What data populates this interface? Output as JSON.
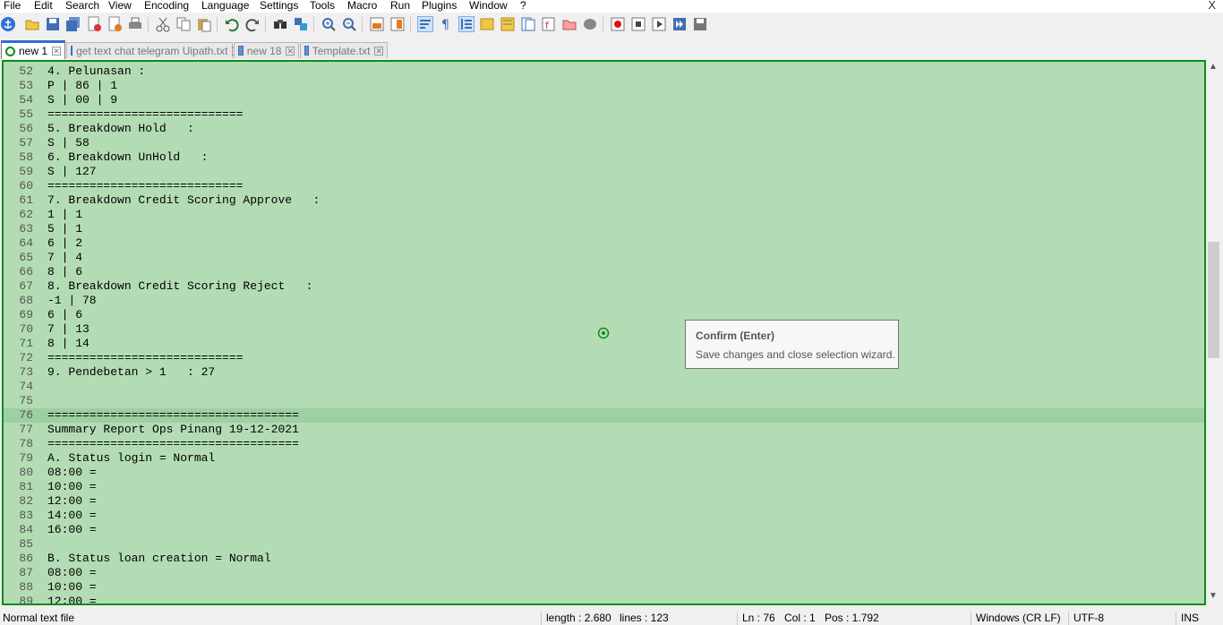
{
  "menu": [
    "File",
    "Edit",
    "Search",
    "View",
    "Encoding",
    "Language",
    "Settings",
    "Tools",
    "Macro",
    "Run",
    "Plugins",
    "Window",
    "?"
  ],
  "window_close_glyph": "X",
  "tabs": [
    {
      "label": "new 1",
      "active": true
    },
    {
      "label": "get text chat telegram Uipath.txt",
      "active": false
    },
    {
      "label": "new 18",
      "active": false
    },
    {
      "label": "Template.txt",
      "active": false
    }
  ],
  "editor": {
    "lines": [
      {
        "n": "52",
        "text": "4. Pelunasan :"
      },
      {
        "n": "53",
        "text": "P | 86 | 1"
      },
      {
        "n": "54",
        "text": "S | 00 | 9"
      },
      {
        "n": "55",
        "text": "============================"
      },
      {
        "n": "56",
        "text": "5. Breakdown Hold   :"
      },
      {
        "n": "57",
        "text": "S | 58"
      },
      {
        "n": "58",
        "text": "6. Breakdown UnHold   :"
      },
      {
        "n": "59",
        "text": "S | 127"
      },
      {
        "n": "60",
        "text": "============================"
      },
      {
        "n": "61",
        "text": "7. Breakdown Credit Scoring Approve   :"
      },
      {
        "n": "62",
        "text": "1 | 1"
      },
      {
        "n": "63",
        "text": "5 | 1"
      },
      {
        "n": "64",
        "text": "6 | 2"
      },
      {
        "n": "65",
        "text": "7 | 4"
      },
      {
        "n": "66",
        "text": "8 | 6"
      },
      {
        "n": "67",
        "text": "8. Breakdown Credit Scoring Reject   :"
      },
      {
        "n": "68",
        "text": "-1 | 78"
      },
      {
        "n": "69",
        "text": "6 | 6"
      },
      {
        "n": "70",
        "text": "7 | 13"
      },
      {
        "n": "71",
        "text": "8 | 14"
      },
      {
        "n": "72",
        "text": "============================"
      },
      {
        "n": "73",
        "text": "9. Pendebetan > 1   : 27"
      },
      {
        "n": "74",
        "text": ""
      },
      {
        "n": "75",
        "text": ""
      },
      {
        "n": "76",
        "text": "====================================",
        "current": true
      },
      {
        "n": "77",
        "text": "Summary Report Ops Pinang 19-12-2021"
      },
      {
        "n": "78",
        "text": "===================================="
      },
      {
        "n": "79",
        "text": "A. Status login = Normal"
      },
      {
        "n": "80",
        "text": "08:00 ="
      },
      {
        "n": "81",
        "text": "10:00 ="
      },
      {
        "n": "82",
        "text": "12:00 ="
      },
      {
        "n": "83",
        "text": "14:00 ="
      },
      {
        "n": "84",
        "text": "16:00 ="
      },
      {
        "n": "85",
        "text": ""
      },
      {
        "n": "86",
        "text": "B. Status loan creation = Normal"
      },
      {
        "n": "87",
        "text": "08:00 ="
      },
      {
        "n": "88",
        "text": "10:00 ="
      },
      {
        "n": "89",
        "text": "12:00 ="
      }
    ]
  },
  "tooltip": {
    "title": "Confirm (Enter)",
    "description": "Save changes and close selection wizard."
  },
  "status": {
    "file_type": "Normal text file",
    "length": "length : 2.680",
    "lines": "lines : 123",
    "ln": "Ln : 76",
    "col": "Col : 1",
    "pos": "Pos : 1.792",
    "eol": "Windows (CR LF)",
    "encoding": "UTF-8",
    "mode": "INS"
  },
  "colors": {
    "editor_bg": "#b3dcb4",
    "editor_border": "#0f8a1c",
    "current_line": "#9ecfa2",
    "active_tab_accent": "#2f6fd6"
  }
}
